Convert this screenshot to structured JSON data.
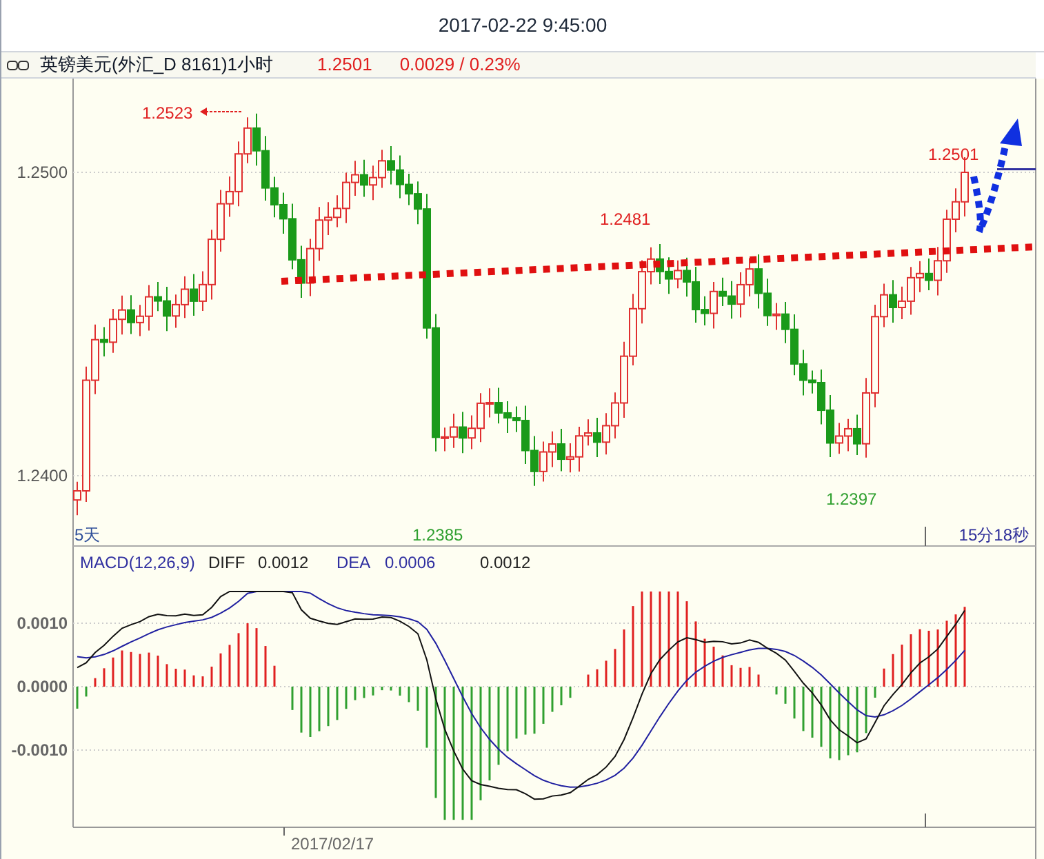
{
  "header": {
    "datetime": "2017-02-22 9:45:00"
  },
  "instrument": {
    "name": "英镑美元(外汇_D 8161)1小时",
    "price": "1.2501",
    "change": "0.0029 / 0.23%"
  },
  "price_chart": {
    "y_ticks": [
      "1.2500",
      "1.2400"
    ],
    "period_label": "5天",
    "countdown": "15分18秒",
    "annotations": [
      {
        "label": "1.2523",
        "kind": "high_pointer"
      },
      {
        "label": "1.2481",
        "kind": "high"
      },
      {
        "label": "1.2501",
        "kind": "high"
      },
      {
        "label": "1.2385",
        "kind": "low"
      },
      {
        "label": "1.2397",
        "kind": "low"
      }
    ]
  },
  "macd": {
    "title": "MACD(12,26,9)",
    "diff_label": "DIFF",
    "diff": "0.0012",
    "dea_label": "DEA",
    "dea": "0.0006",
    "macd": "0.0012",
    "y_ticks": [
      "0.0010",
      "0.0000",
      "-0.0010"
    ]
  },
  "x_axis": {
    "date": "2017/02/17"
  }
}
